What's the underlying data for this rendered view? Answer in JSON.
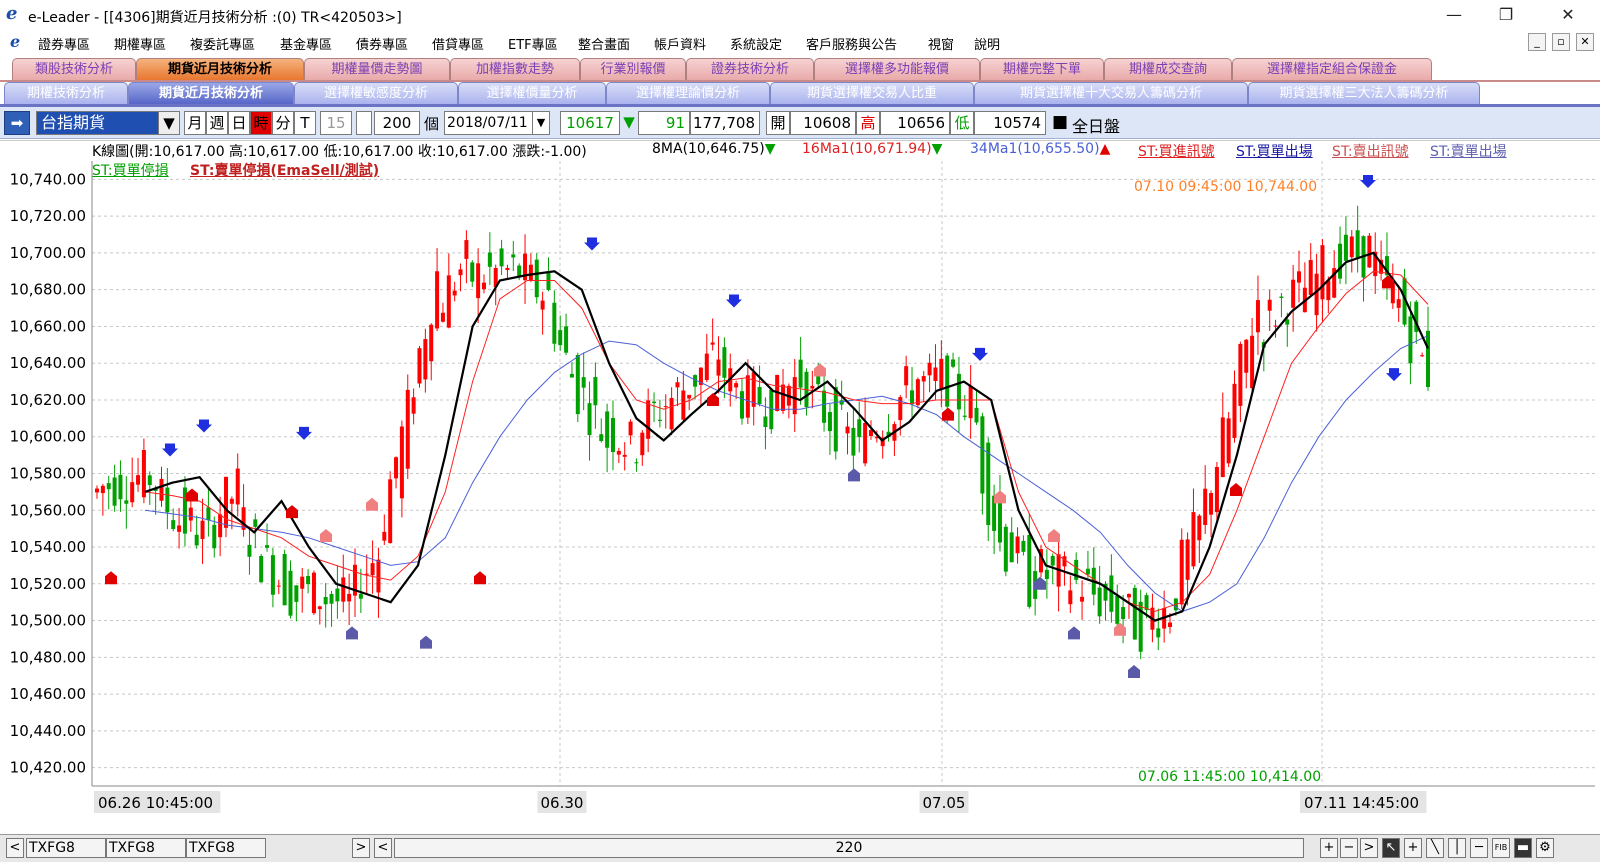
{
  "window": {
    "title": "e-Leader - [[4306]期貨近月技術分析 :(0) TR<420503>]",
    "logo_icon": "e-leader-logo-icon"
  },
  "menu": [
    "證券專區",
    "期權專區",
    "複委託專區",
    "基金專區",
    "債券專區",
    "借貸專區",
    "ETF專區",
    "整合畫面",
    "帳戶資料",
    "系統設定",
    "客戶服務與公告",
    "視窗",
    "說明"
  ],
  "tabs_row1": [
    "類股技術分析",
    "期貨近月技術分析",
    "期權量價走勢圖",
    "加權指數走勢",
    "行業別報價",
    "證券技術分析",
    "選擇權多功能報價",
    "期權完整下單",
    "期權成交查詢",
    "選擇權指定組合保證金"
  ],
  "tabs_row2": [
    "期權技術分析",
    "期貨近月技術分析",
    "選擇權敏感度分析",
    "選擇權價量分析",
    "選擇權理論價分析",
    "期貨選擇權交易人比重",
    "期貨選擇權十大交易人籌碼分析",
    "期貨選擇權三大法人籌碼分析"
  ],
  "toolbar": {
    "product": "台指期貨",
    "periods": [
      "月",
      "週",
      "日",
      "時",
      "分",
      "T"
    ],
    "active_period": "時",
    "interval": "15",
    "count": "200",
    "count_unit": "個",
    "date": "2018/07/11",
    "last_price": "10617",
    "change": "91",
    "volume": "177,708",
    "open_label": "開",
    "open": "10608",
    "high_label": "高",
    "high": "10656",
    "low_label": "低",
    "low": "10574",
    "full_session": "全日盤",
    "colors": {
      "up": "#e00000",
      "down": "#00a000",
      "active_period_bg": "#e00000"
    }
  },
  "legend": {
    "kline": "K線圖(開:10,617.00 高:10,617.00 低:10,617.00 收:10,617.00 漲跌:-1.00)",
    "ma8": "8MA(10,646.75)",
    "ma16": "16Ma1(10,671.94)",
    "ma34": "34Ma1(10,655.50)",
    "st_buy_signal": "ST:買進訊號",
    "st_buy_exit": "ST:買單出場",
    "st_sell_signal": "ST:賣出訊號",
    "st_sell_exit": "ST:賣單出場",
    "st_buy_stop": "ST:買單停損",
    "st_sell_stop": "ST:賣單停損(EmaSell/測試)"
  },
  "chart_data": {
    "type": "candlestick",
    "instrument": "台指期貨",
    "ylim": [
      10410,
      10750
    ],
    "y_ticks": [
      "10,740.00",
      "10,720.00",
      "10,700.00",
      "10,680.00",
      "10,660.00",
      "10,640.00",
      "10,620.00",
      "10,600.00",
      "10,580.00",
      "10,560.00",
      "10,540.00",
      "10,520.00",
      "10,500.00",
      "10,480.00",
      "10,460.00",
      "10,440.00",
      "10,420.00"
    ],
    "x_labels": [
      "06.26 10:45:00",
      "06.30",
      "07.05",
      "07.11 14:45:00"
    ],
    "annotations": {
      "high_label": "07.10 09:45:00  10,744.00",
      "low_label": "07.06 11:45:00  10,414.00"
    },
    "ma8_approx": [
      10570,
      10575,
      10578,
      10560,
      10548,
      10565,
      10540,
      10520,
      10515,
      10510,
      10530,
      10590,
      10660,
      10685,
      10688,
      10690,
      10680,
      10640,
      10610,
      10598,
      10612,
      10625,
      10640,
      10625,
      10620,
      10630,
      10615,
      10598,
      10608,
      10625,
      10630,
      10620,
      10560,
      10530,
      10525,
      10520,
      10510,
      10500,
      10505,
      10540,
      10590,
      10650,
      10668,
      10680,
      10695,
      10700,
      10680,
      10648
    ],
    "ma16_approx": [
      10570,
      10568,
      10565,
      10555,
      10550,
      10545,
      10535,
      10530,
      10525,
      10522,
      10535,
      10570,
      10630,
      10675,
      10685,
      10685,
      10670,
      10640,
      10620,
      10615,
      10620,
      10630,
      10632,
      10628,
      10626,
      10624,
      10620,
      10618,
      10618,
      10620,
      10620,
      10620,
      10570,
      10540,
      10530,
      10520,
      10510,
      10505,
      10510,
      10525,
      10560,
      10600,
      10640,
      10660,
      10678,
      10690,
      10688,
      10672
    ],
    "ma34_approx": [
      10560,
      10558,
      10556,
      10552,
      10550,
      10548,
      10545,
      10540,
      10535,
      10530,
      10532,
      10545,
      10575,
      10600,
      10620,
      10635,
      10645,
      10652,
      10650,
      10640,
      10632,
      10625,
      10620,
      10615,
      10615,
      10618,
      10620,
      10622,
      10618,
      10612,
      10600,
      10590,
      10580,
      10570,
      10560,
      10548,
      10530,
      10515,
      10505,
      10510,
      10520,
      10545,
      10575,
      10600,
      10620,
      10635,
      10648,
      10655
    ],
    "series_colors": {
      "up": "#ff0000",
      "down": "#00a000",
      "ma8": "#000000",
      "ma16": "#ff2020",
      "ma34": "#4b5fd6"
    }
  },
  "statusbar": {
    "tabs": [
      "TXFG8",
      "TXFG8",
      "TXFG8"
    ],
    "count": "220"
  }
}
